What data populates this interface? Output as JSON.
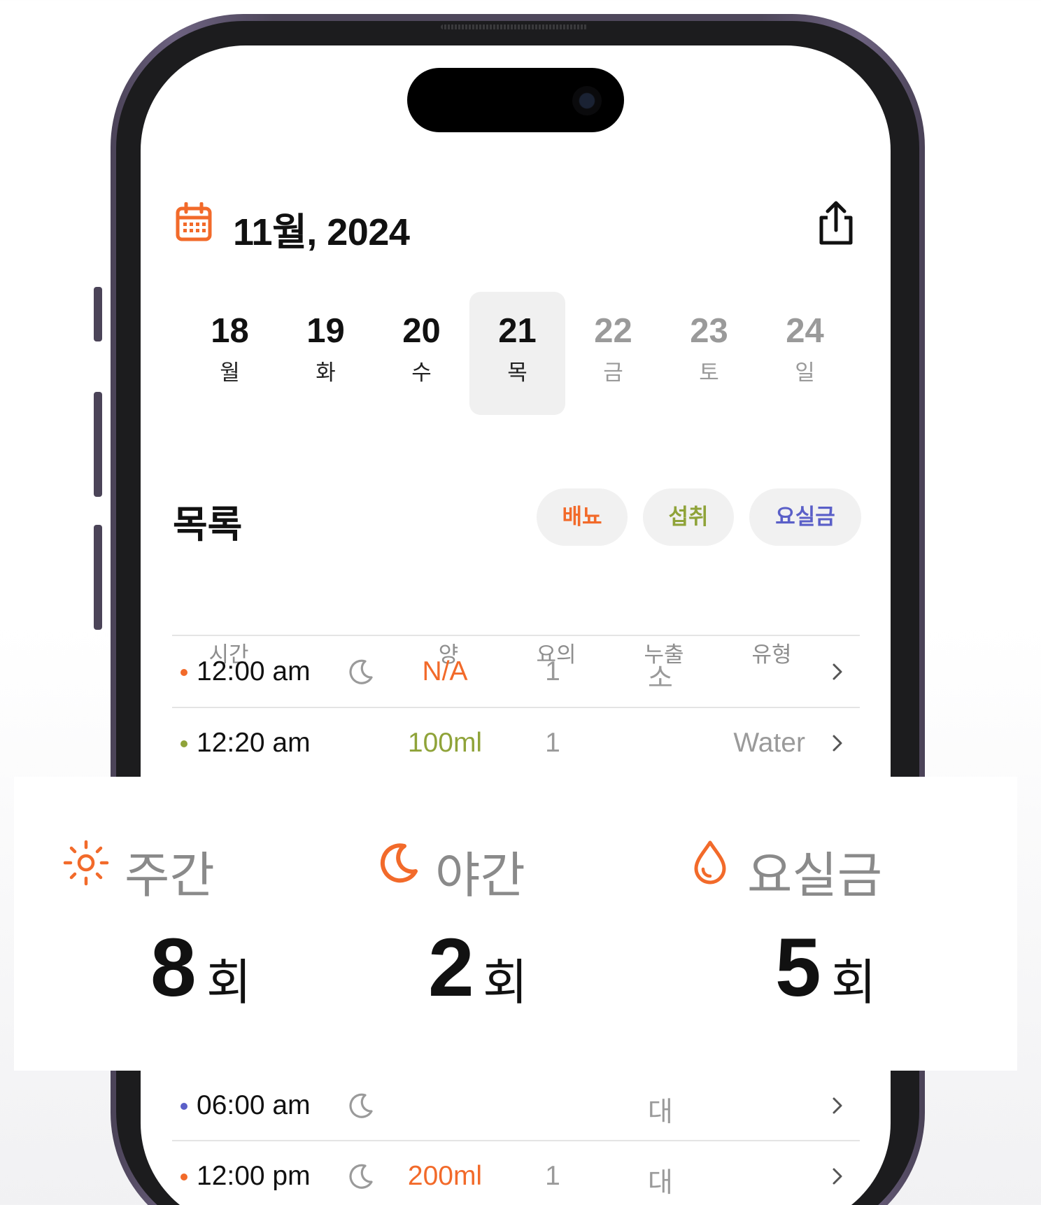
{
  "colors": {
    "accent_orange": "#f26a2a",
    "intake_green": "#8fa339",
    "incontinence_blue": "#5a5fc8",
    "muted_gray": "#9a9a9a"
  },
  "header": {
    "month_title": "11월, 2024",
    "calendar_icon": "calendar-icon",
    "share_icon": "share-icon"
  },
  "days": [
    {
      "num": "18",
      "weekday": "월"
    },
    {
      "num": "19",
      "weekday": "화"
    },
    {
      "num": "20",
      "weekday": "수"
    },
    {
      "num": "21",
      "weekday": "목",
      "selected": true
    },
    {
      "num": "22",
      "weekday": "금"
    },
    {
      "num": "23",
      "weekday": "토"
    },
    {
      "num": "24",
      "weekday": "일"
    }
  ],
  "list": {
    "title": "목록",
    "chips": [
      "배뇨",
      "섭취",
      "요실금"
    ],
    "columns": {
      "time": "시간",
      "amount": "양",
      "urge": "요의",
      "leak": "누출",
      "type": "유형"
    },
    "rows": [
      {
        "time": "12:00 am",
        "night": true,
        "amount": "N/A",
        "urge": "1",
        "leak": "소",
        "type": ""
      },
      {
        "time": "12:20 am",
        "night": false,
        "amount": "100ml",
        "urge": "1",
        "leak": "",
        "type": "Water"
      },
      {
        "time": "06:00 am",
        "night": true,
        "amount": "",
        "urge": "",
        "leak": "대",
        "type": ""
      },
      {
        "time": "12:00 pm",
        "night": true,
        "amount": "200ml",
        "urge": "1",
        "leak": "대",
        "type": ""
      }
    ]
  },
  "summary": {
    "day": {
      "label": "주간",
      "value": "8",
      "unit": "회",
      "icon": "sun-icon"
    },
    "night": {
      "label": "야간",
      "value": "2",
      "unit": "회",
      "icon": "moon-icon"
    },
    "incontinence": {
      "label": "요실금",
      "value": "5",
      "unit": "회",
      "icon": "drop-icon"
    }
  }
}
